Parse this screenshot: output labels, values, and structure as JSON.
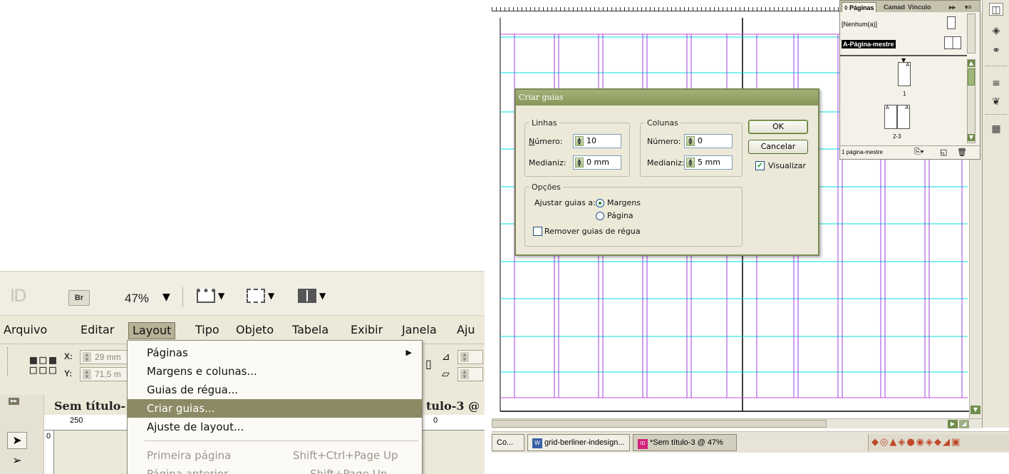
{
  "left": {
    "toolbar": {
      "br_label": "Br",
      "zoom": "47%",
      "caret": "▼"
    },
    "menubar": [
      "Arquivo",
      "Editar",
      "Layout",
      "Tipo",
      "Objeto",
      "Tabela",
      "Exibir",
      "Janela",
      "Aju"
    ],
    "control_panel": {
      "x_label": "X:",
      "x_value": "29 mm",
      "y_label": "Y:",
      "y_value": "71,5 m"
    },
    "doc_tab_left": "Sem título-",
    "doc_tab_right": "tulo-3 @",
    "ruler_250": "250",
    "ruler_0": "0",
    "ruler_v0": "0",
    "layout_menu": {
      "items": [
        {
          "label": "Páginas",
          "submenu_arrow": "▶"
        },
        {
          "label": "Margens e colunas..."
        },
        {
          "label": "Guias de régua..."
        },
        {
          "label": "Criar guias..."
        },
        {
          "label": "Ajuste de layout..."
        },
        {
          "label": "Primeira página",
          "shortcut": "Shift+Ctrl+Page Up"
        },
        {
          "label": "Página anterior",
          "shortcut": "Shift+Page Up"
        }
      ]
    }
  },
  "right": {
    "pages_panel": {
      "tabs": [
        "◊ Páginas",
        "Camad",
        "Vínculo",
        "▸▸",
        "▾≡"
      ],
      "none_label": "[Nenhum(a)]",
      "master_label": "A-Página-mestre",
      "page1_label": "1",
      "spread_label": "2-3",
      "thumb_marker": "A",
      "footer_label": "1 página-mestre"
    },
    "dialog": {
      "title": "Criar guias",
      "rows_group": "Linhas",
      "cols_group": "Colunas",
      "rows_number_label": "Número:",
      "rows_number_value": "10",
      "rows_gutter_label": "Medianiz:",
      "rows_gutter_value": "0 mm",
      "cols_number_label": "Número:",
      "cols_number_value": "0",
      "cols_gutter_label": "Medianiz:",
      "cols_gutter_value": "5 mm",
      "ok_label": "OK",
      "cancel_label": "Cancelar",
      "preview_label": "Visualizar",
      "options_group": "Opções",
      "fit_label": "Ajustar guias a:",
      "fit_margins": "Margens",
      "fit_page": "Página",
      "remove_label": "Remover guias de régua"
    },
    "taskbar": {
      "items": [
        "Co...",
        "grid-berliner-indesign...",
        "*Sem título-3 @ 47%"
      ],
      "app_badge_1": "W",
      "app_badge_2": "ID"
    },
    "colors": {
      "guide_cyan": "#00dede",
      "column_magenta": "#c94ce0",
      "margin_purple": "#9d3fe0",
      "title_bar_olive": "#879558"
    }
  }
}
